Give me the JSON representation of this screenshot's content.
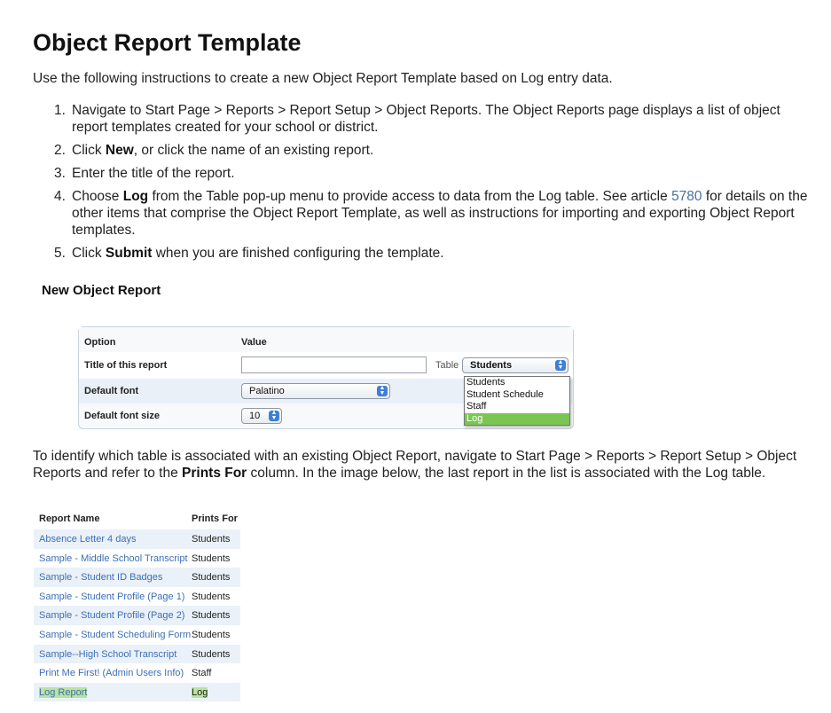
{
  "page": {
    "title": "Object Report Template",
    "intro": "Use the following instructions to create a new Object Report Template based on Log entry data."
  },
  "steps": [
    {
      "num": "1.",
      "text": "Navigate to Start Page > Reports > Report Setup > Object Reports. The Object Reports page displays a list of object report templates created for your school or district."
    },
    {
      "num": "2.",
      "pre": "Click ",
      "bold": "New",
      "post": ", or click the name of an existing report."
    },
    {
      "num": "3.",
      "text": "Enter the title of the report."
    },
    {
      "num": "4.",
      "pre": "Choose ",
      "bold": "Log",
      "mid": " from the Table pop-up menu to provide access to data from the Log table. See article ",
      "link": "5780",
      "post": " for details on the other items that comprise the Object Report Template, as well as instructions for importing and exporting Object Report templates."
    },
    {
      "num": "5.",
      "pre": "Click ",
      "bold": "Submit",
      "post": " when you are finished configuring the template."
    }
  ],
  "new_report": {
    "heading": "New Object Report",
    "col_option": "Option",
    "col_value": "Value",
    "title_label": "Title of this report",
    "title_value": "",
    "table_label": "Table",
    "table_selected": "Students",
    "table_options": [
      "Students",
      "Student Schedule",
      "Staff",
      "Log"
    ],
    "table_highlighted": "Log",
    "font_label": "Default font",
    "font_value": "Palatino",
    "size_label": "Default font size",
    "size_value": "10"
  },
  "explain": {
    "pre": "To identify which table is associated with an existing Object Report, navigate to Start Page > Reports > Report Setup > Object Reports and refer to the ",
    "bold": "Prints For",
    "post": " column. In the image below, the last report in the list is associated with the Log table."
  },
  "report_list": {
    "col_name": "Report Name",
    "col_prints": "Prints For",
    "rows": [
      {
        "name": "Absence Letter 4 days",
        "prints": "Students"
      },
      {
        "name": "Sample - Middle School Transcript",
        "prints": "Students"
      },
      {
        "name": "Sample - Student ID Badges",
        "prints": "Students"
      },
      {
        "name": "Sample - Student Profile (Page 1)",
        "prints": "Students"
      },
      {
        "name": "Sample - Student Profile (Page 2)",
        "prints": "Students"
      },
      {
        "name": "Sample - Student Scheduling Form",
        "prints": "Students"
      },
      {
        "name": "Sample--High School Transcript",
        "prints": "Students"
      },
      {
        "name": "Print Me First! (Admin Users Info)",
        "prints": "Staff"
      },
      {
        "name": "Log Report",
        "prints": "Log"
      }
    ]
  },
  "colors": {
    "link": "#3c6fb6",
    "article_link": "#4a6f9e",
    "highlight": "#b9e39f",
    "dropdown_selected": "#7bc653",
    "alt_row": "#eaf1f8"
  }
}
